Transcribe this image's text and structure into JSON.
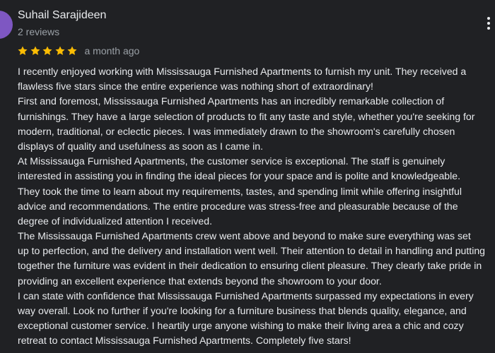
{
  "review": {
    "reviewer_name": "Suhail Sarajideen",
    "review_count": "2 reviews",
    "rating": 5,
    "rating_max": 5,
    "star_color": "#fbbc04",
    "date": "a month ago",
    "menu_icon": "more-vert-icon",
    "avatar_color": "#7e57c2",
    "body_lines": [
      "I recently enjoyed working with Mississauga Furnished Apartments to furnish my unit. They received a",
      "flawless five stars since the entire experience was nothing short of extraordinary!",
      "First and foremost, Mississauga Furnished Apartments has an incredibly remarkable collection of",
      "furnishings. They have a large selection of products to fit any taste and style, whether you're seeking for",
      "modern, traditional, or eclectic pieces. I was immediately drawn to the showroom's carefully chosen",
      "displays of quality and usefulness as soon as I came in.",
      "At Mississauga Furnished Apartments, the customer service is exceptional. The staff is genuinely",
      "interested in assisting you in finding the ideal pieces for your space and is polite and knowledgeable.",
      "They took the time to learn about my requirements, tastes, and spending limit while offering insightful",
      "advice and recommendations. The entire procedure was stress-free and pleasurable because of the",
      "degree of individualized attention I received.",
      "The Mississauga Furnished Apartments crew went above and beyond to make sure everything was set",
      "up to perfection, and the delivery and installation went well. Their attention to detail in handling and putting",
      "together the furniture was evident in their dedication to ensuring client pleasure. They clearly take pride in",
      "providing an excellent experience that extends beyond the showroom to your door.",
      "I can state with confidence that Mississauga Furnished Apartments surpassed my expectations in every",
      "way overall. Look no further if you're looking for a furniture business that blends quality, elegance, and",
      "exceptional customer service. I heartily urge anyone wishing to make their living area a chic and cozy",
      "retreat to contact Mississauga Furnished Apartments. Completely five stars!"
    ]
  }
}
